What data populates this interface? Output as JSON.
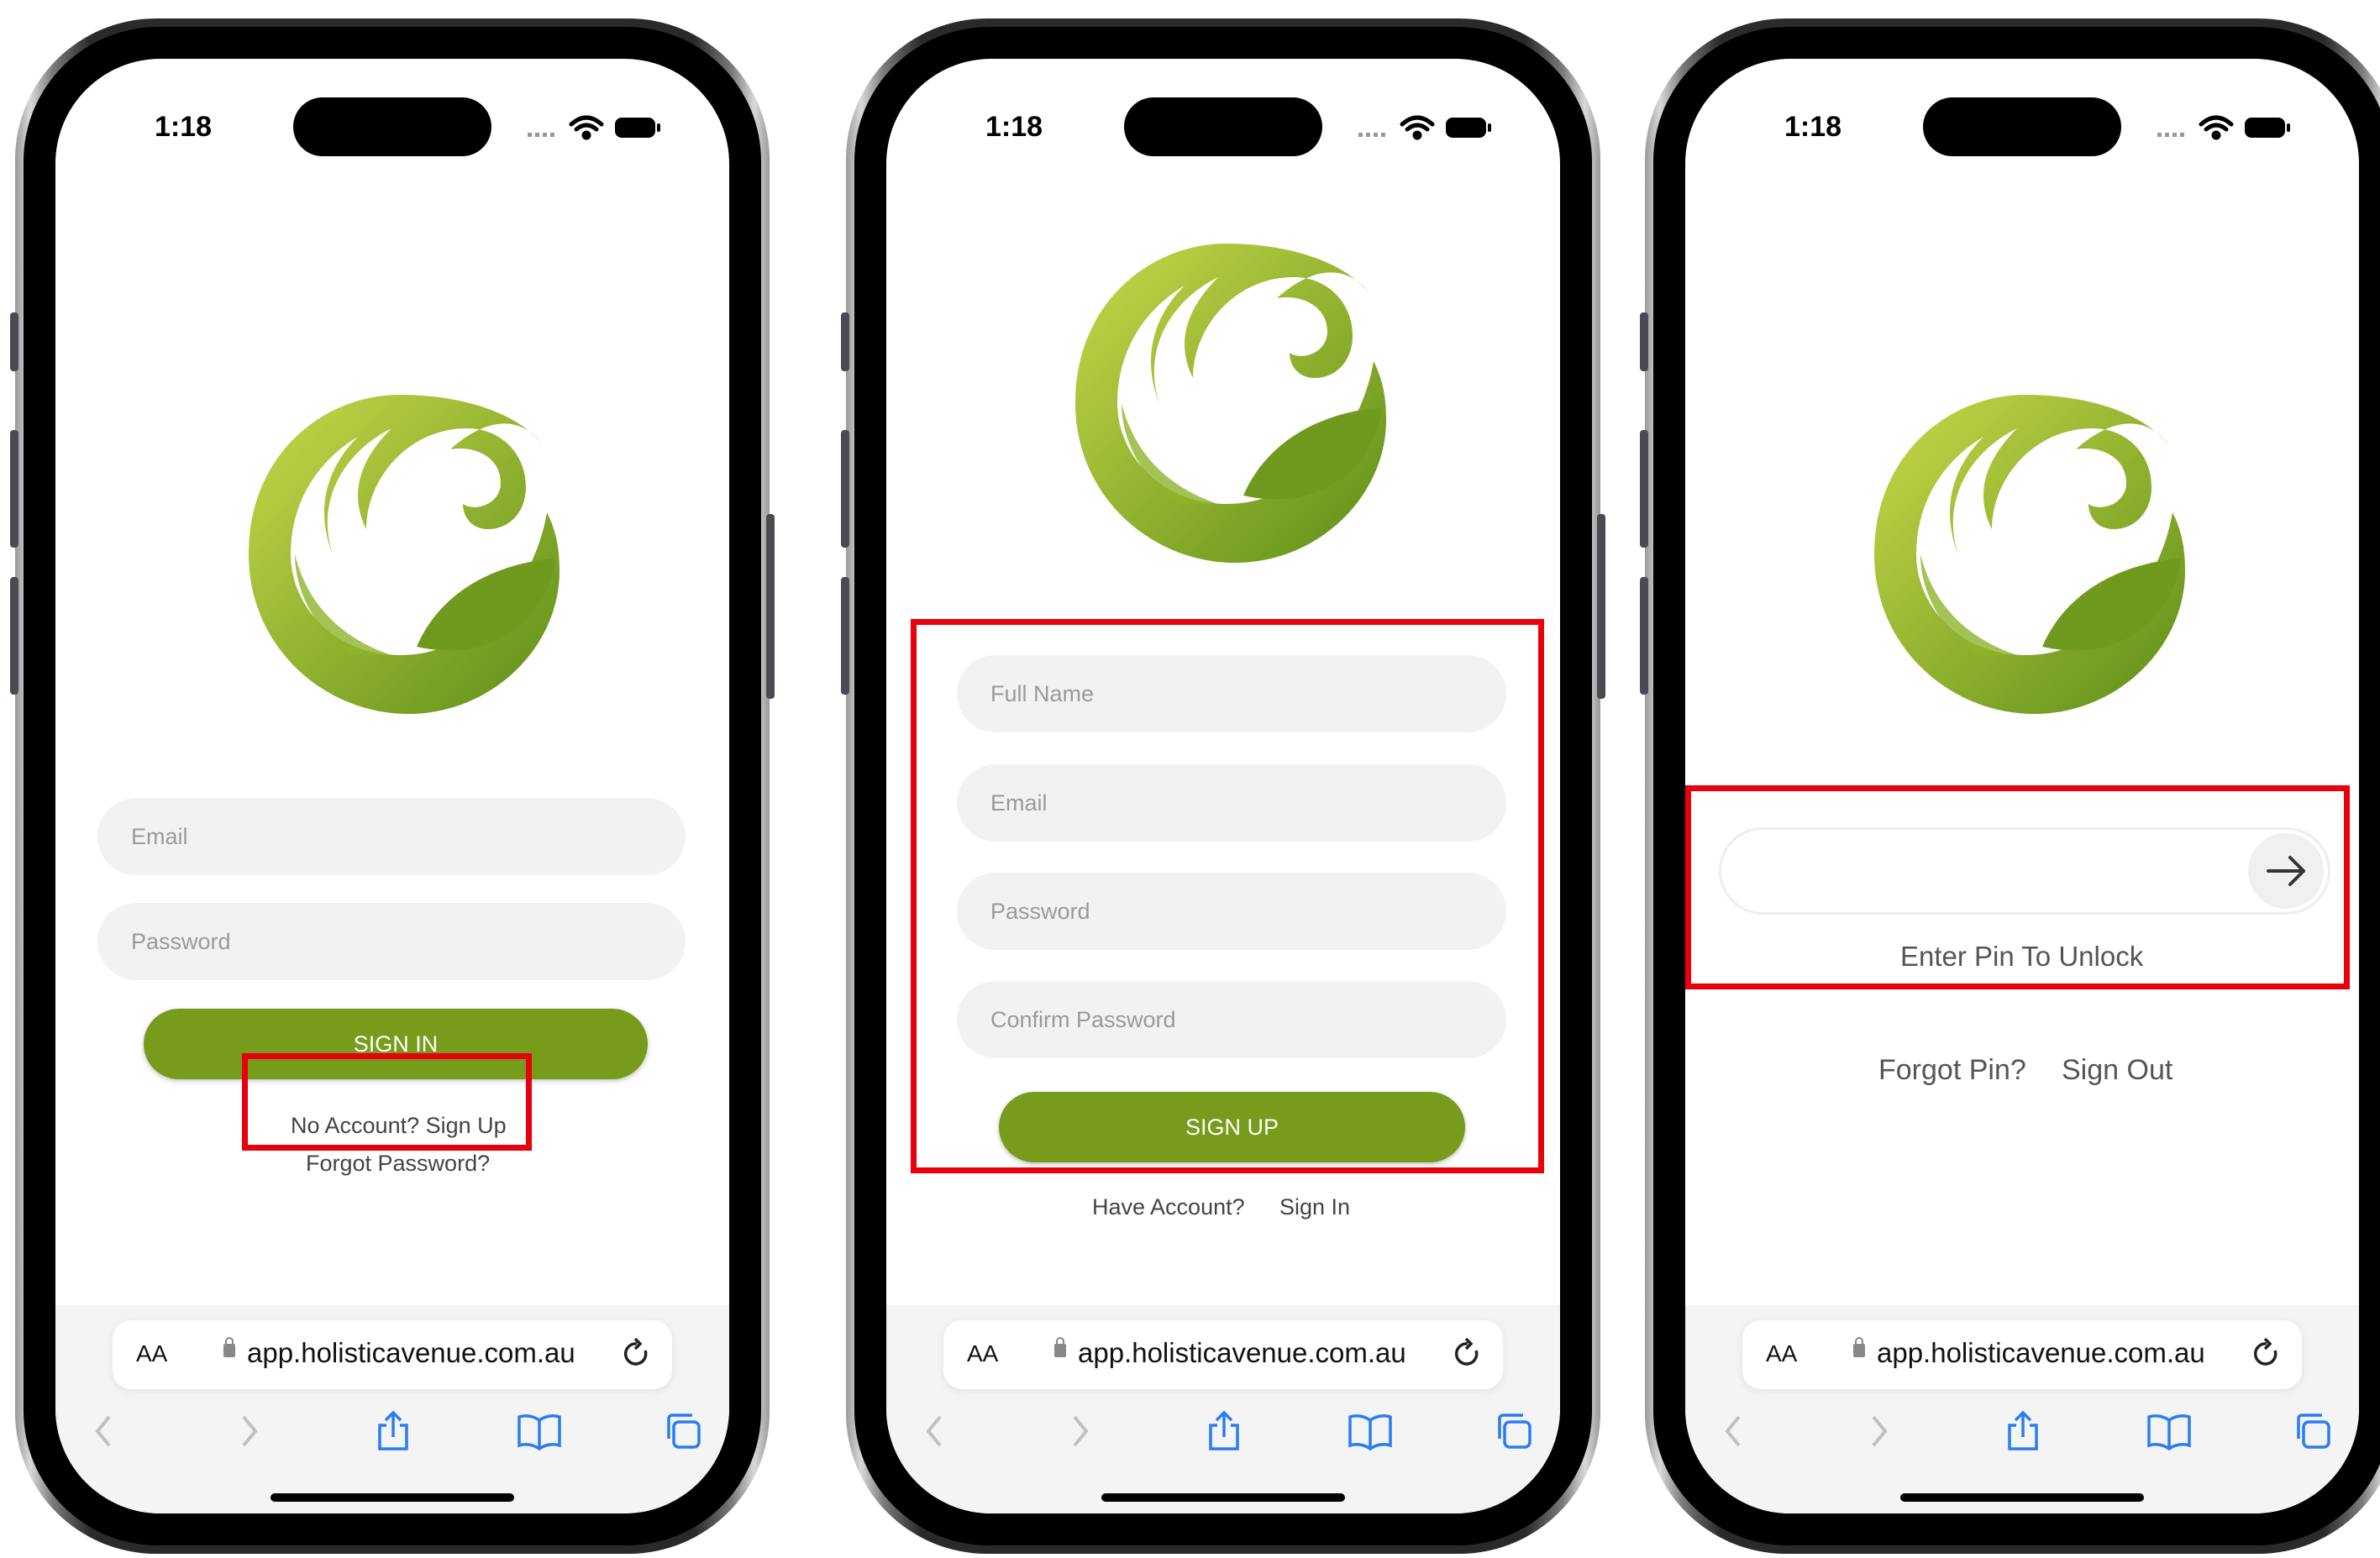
{
  "status_bar": {
    "time": "1:18"
  },
  "logo": {
    "name": "leaf-swirl-logo",
    "colors": {
      "light": "#a8c43a",
      "dark": "#6f9a1e"
    }
  },
  "browser": {
    "aa_label": "AA",
    "url": "app.holisticavenue.com.au"
  },
  "colors": {
    "accent": "#779c1c",
    "highlight": "#e8000d"
  },
  "screens": {
    "signin": {
      "email_placeholder": "Email",
      "password_placeholder": "Password",
      "signin_label": "SIGN IN",
      "signup_link": "No Account? Sign Up",
      "forgot_link": "Forgot Password?"
    },
    "signup": {
      "fullname_placeholder": "Full Name",
      "email_placeholder": "Email",
      "password_placeholder": "Password",
      "confirm_placeholder": "Confirm Password",
      "signup_label": "SIGN UP",
      "have_account": "Have Account?",
      "signin_link": "Sign In"
    },
    "pin": {
      "pin_label": "Enter Pin To Unlock",
      "forgot_pin": "Forgot Pin?",
      "sign_out": "Sign Out"
    }
  }
}
